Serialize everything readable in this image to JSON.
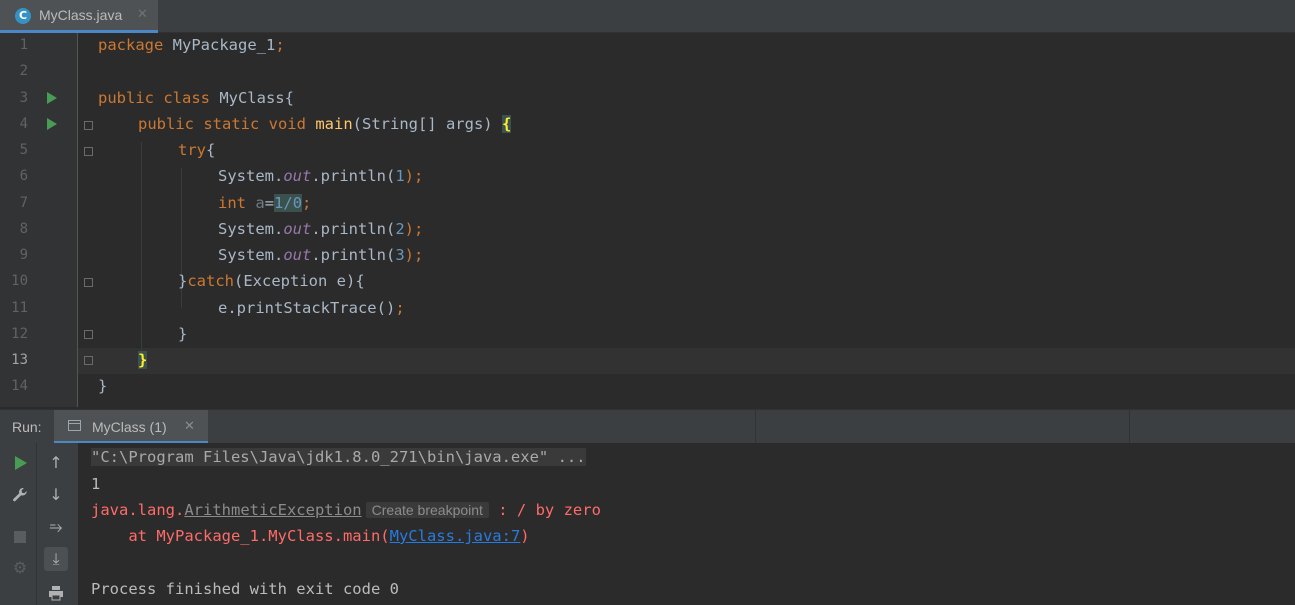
{
  "editor_tab": {
    "title": "MyClass.java",
    "icon": "class-c-icon",
    "icon_letter": "C",
    "close": "✕"
  },
  "editor": {
    "line_numbers": [
      "1",
      "2",
      "3",
      "4",
      "5",
      "6",
      "7",
      "8",
      "9",
      "10",
      "11",
      "12",
      "13",
      "14"
    ],
    "current_line": "13",
    "code": {
      "l1": [
        "package",
        " MyPackage_1",
        ";"
      ],
      "l3": [
        "public class",
        " MyClass{"
      ],
      "l4": [
        "public static void",
        " ",
        "main",
        "(String[] args) ",
        "{"
      ],
      "l5": [
        "try",
        "{"
      ],
      "l6": [
        "System.",
        "out",
        ".println(",
        "1",
        ");"
      ],
      "l7": [
        "int",
        " ",
        "a",
        "=",
        "1/0",
        ";"
      ],
      "l8": [
        "System.",
        "out",
        ".println(",
        "2",
        ");"
      ],
      "l9": [
        "System.",
        "out",
        ".println(",
        "3",
        ");"
      ],
      "l10": [
        "}",
        "catch",
        "(Exception e){"
      ],
      "l11": [
        "e.printStackTrace()",
        ";"
      ],
      "l12": [
        "}"
      ],
      "l13": [
        "}"
      ],
      "l14": [
        "}"
      ]
    }
  },
  "run_panel": {
    "label": "Run:",
    "tab_title": "MyClass (1)",
    "tab_close": "✕",
    "toolbar": {
      "rerun": "rerun-icon",
      "up": "↑",
      "down": "↓",
      "settings": "wrench-icon",
      "soft_wrap": "⥱",
      "stop": "stop-icon",
      "scroll_end": "⤓",
      "bug": "⚙",
      "print": "print-icon"
    },
    "output": {
      "cmd": "\"C:\\Program Files\\Java\\jdk1.8.0_271\\bin\\java.exe\" ...",
      "line1": "1",
      "exc_prefix": "java.lang.",
      "exc_name": "ArithmeticException",
      "create_breakpoint": "Create breakpoint",
      "exc_msg": " : / by zero",
      "at_prefix": "    at MyPackage_1.MyClass.main(",
      "at_link": "MyClass.java:7",
      "at_suffix": ")",
      "finished": "Process finished with exit code 0"
    }
  },
  "colors": {
    "background": "#2b2b2b",
    "keyword": "#cc7832",
    "number": "#6897bb",
    "error": "#ff6b68",
    "link": "#287bde",
    "run_green": "#499c54"
  }
}
